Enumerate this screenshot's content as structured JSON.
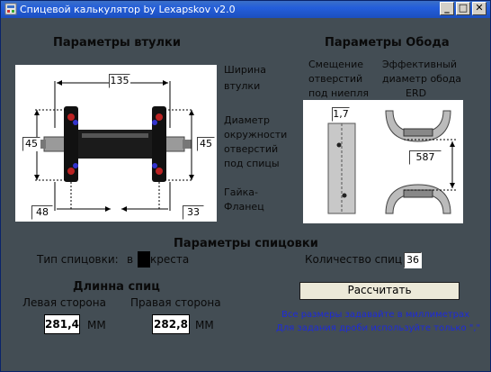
{
  "window": {
    "title": "Спицевой калькулятор by Lexapskov v2.0"
  },
  "hub": {
    "heading": "Параметры втулки",
    "width_value": "135",
    "flange_diam_left": "45",
    "flange_diam_right": "45",
    "offset_left": "48",
    "offset_right": "33",
    "width_label_1": "Ширина",
    "width_label_2": "втулки",
    "diam_label_1": "Диаметр",
    "diam_label_2": "окружности",
    "diam_label_3": "отверстий",
    "diam_label_4": "под спицы",
    "nut_label_1": "Гайка-",
    "nut_label_2": "Фланец"
  },
  "rim": {
    "heading": "Параметры Обода",
    "offset_label_1": "Смещение",
    "offset_label_2": "отверстий",
    "offset_label_3": "под ниепля",
    "erd_label_1": "Эффективный",
    "erd_label_2": "диаметр обода",
    "erd_label_3": "ERD",
    "offset_value": "1,7",
    "erd_value": "587"
  },
  "lacing": {
    "heading": "Параметры спицовки",
    "type_label": "Тип спицовки:",
    "in_label": "в",
    "cross_label": "креста",
    "count_label": "Количество спиц",
    "count_value": "36"
  },
  "length": {
    "heading": "Длинна спиц",
    "left_label": "Левая сторона",
    "right_label": "Правая сторона",
    "left_value": "281,4",
    "right_value": "282,8",
    "unit_left": "ММ",
    "unit_right": "ММ"
  },
  "actions": {
    "calculate_label": "Рассчитать"
  },
  "notes": {
    "line1": "Все размеры задавайте в миллиметрах",
    "line2": "Для задания дроби используйте только \",\""
  }
}
